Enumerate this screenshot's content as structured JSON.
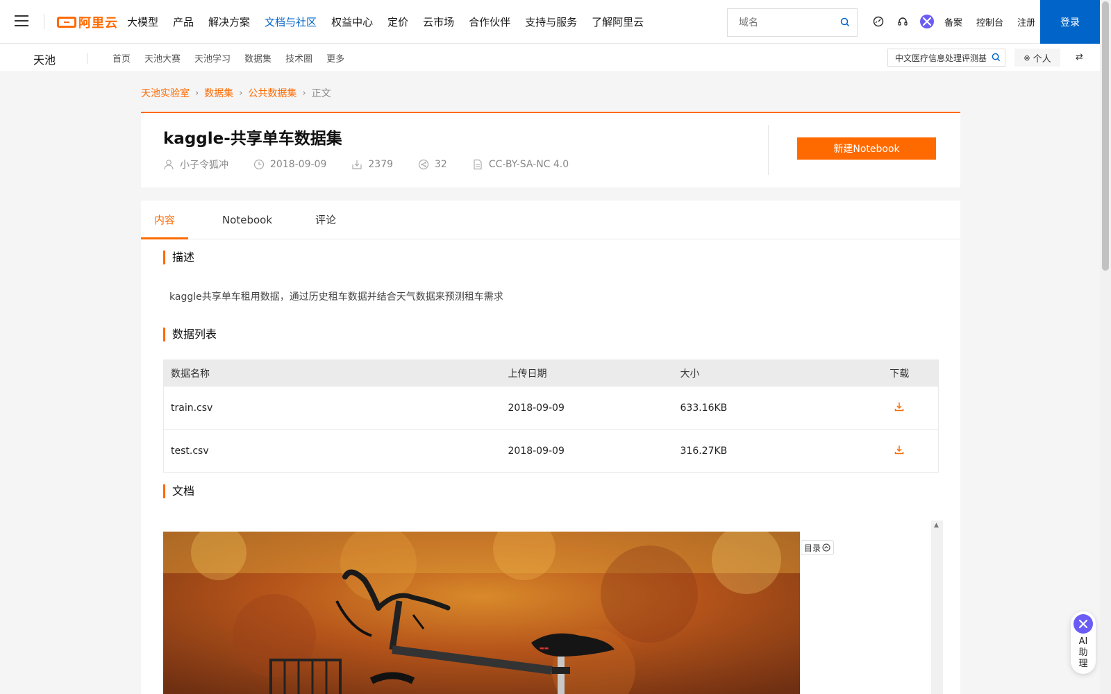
{
  "topnav": {
    "items": [
      "大模型",
      "产品",
      "解决方案",
      "文档与社区",
      "权益中心",
      "定价",
      "云市场",
      "合作伙伴",
      "支持与服务",
      "了解阿里云"
    ],
    "active_index": 3,
    "search_placeholder": "域名",
    "links": [
      "备案",
      "控制台",
      "注册"
    ],
    "login_label": "登录",
    "logo_text": "阿里云",
    "icons": [
      "dashboard-icon",
      "headset-icon",
      "ai-assistant-icon"
    ]
  },
  "subnav": {
    "brand": "天池",
    "items": [
      "首页",
      "天池大赛",
      "天池学习",
      "数据集",
      "技术圈",
      "更多"
    ],
    "search_value": "中文医疗信息处理评测基",
    "personal_label": "个人"
  },
  "breadcrumb": {
    "items": [
      "天池实验室",
      "数据集",
      "公共数据集"
    ],
    "current": "正文"
  },
  "dataset": {
    "title": "kaggle-共享单车数据集",
    "author": "小子令狐冲",
    "date": "2018-09-09",
    "downloads": "2379",
    "shares": "32",
    "license": "CC-BY-SA-NC 4.0",
    "new_notebook_label": "新建Notebook"
  },
  "tabs": {
    "items": [
      "内容",
      "Notebook",
      "评论"
    ],
    "active_index": 0
  },
  "sections": {
    "description_title": "描述",
    "description_text": "kaggle共享单车租用数据，通过历史租车数据并结合天气数据来预测租车需求",
    "data_list_title": "数据列表",
    "document_title": "文档"
  },
  "table": {
    "headers": [
      "数据名称",
      "上传日期",
      "大小",
      "下载"
    ],
    "rows": [
      {
        "name": "train.csv",
        "date": "2018-09-09",
        "size": "633.16KB"
      },
      {
        "name": "test.csv",
        "date": "2018-09-09",
        "size": "316.27KB"
      }
    ]
  },
  "doc": {
    "toc_label": "目录"
  },
  "ai_helper": {
    "label": "AI助理"
  },
  "colors": {
    "accent": "#ff6a00",
    "brand_blue": "#0064c8"
  }
}
